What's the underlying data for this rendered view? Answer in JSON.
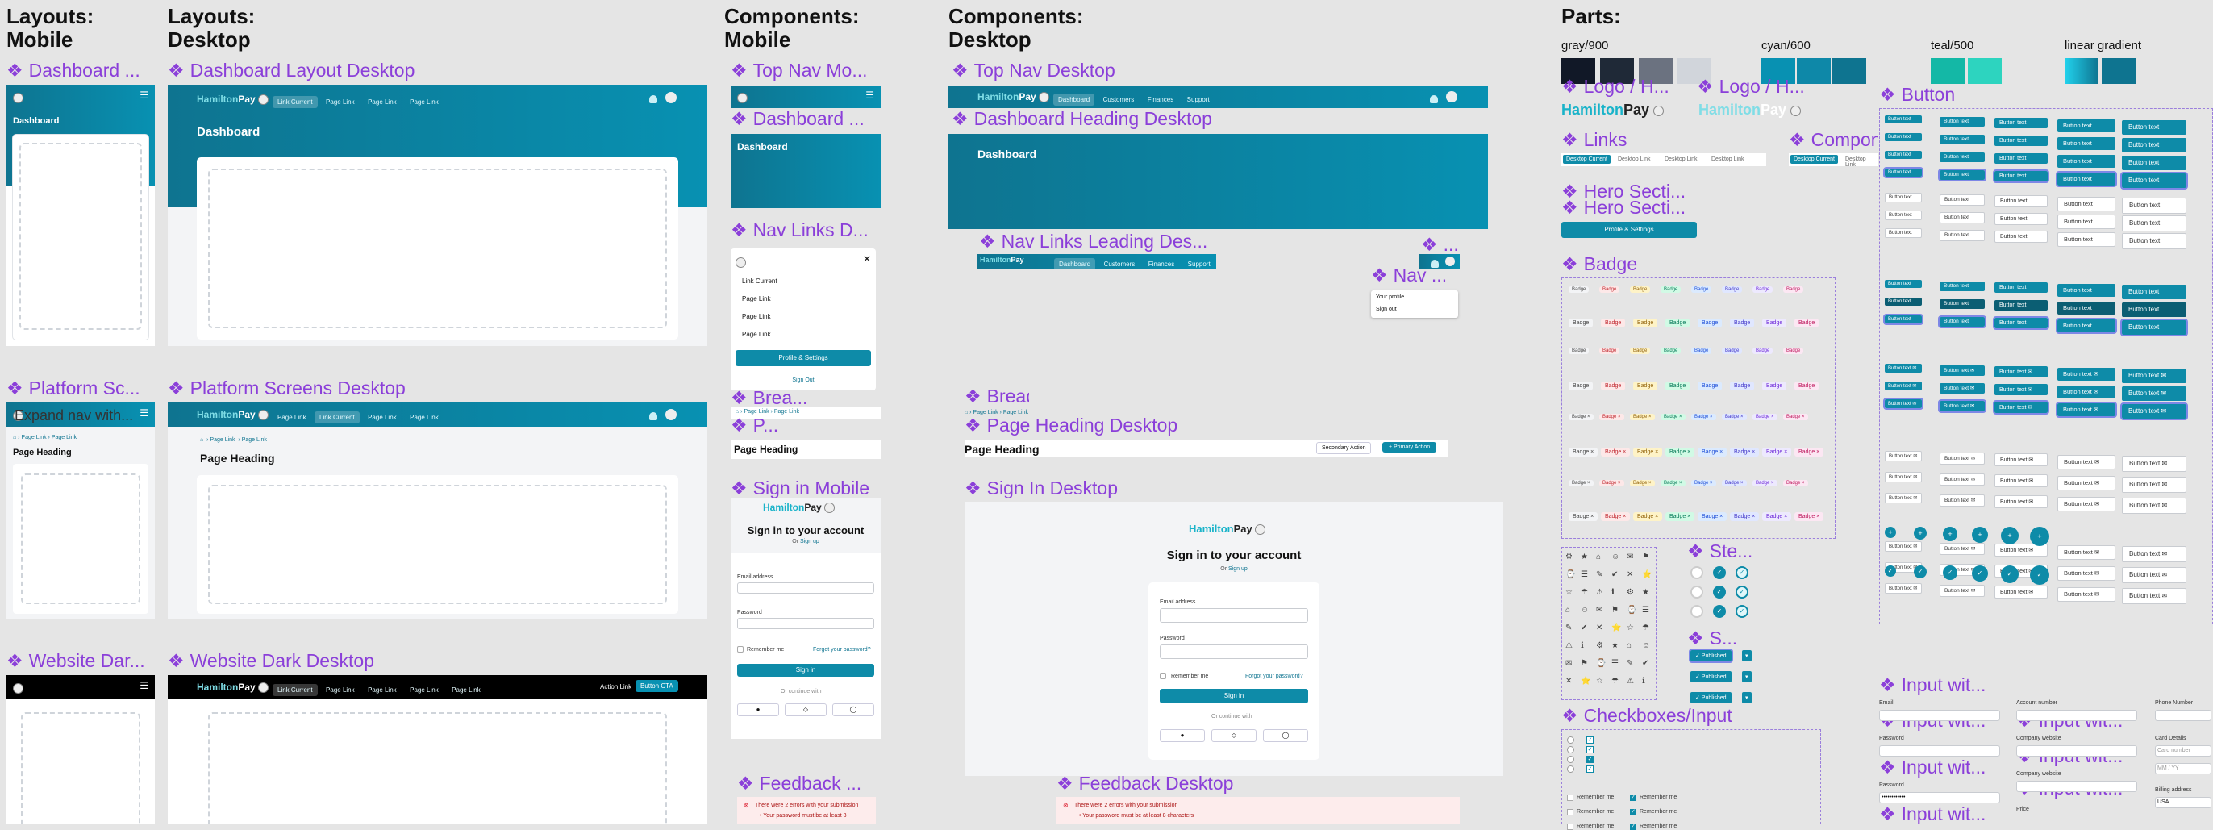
{
  "sections": {
    "layouts_mobile": [
      "Layouts:",
      "Mobile"
    ],
    "layouts_desktop": [
      "Layouts:",
      "Desktop"
    ],
    "components_mobile": [
      "Components:",
      "Mobile"
    ],
    "components_desktop": [
      "Components:",
      "Desktop"
    ],
    "parts": "Parts:"
  },
  "labels": {
    "dashboard_mobile": "Dashboard ...",
    "dashboard_desktop": "Dashboard Layout Desktop",
    "platform_mobile": "Platform Sc...",
    "platform_desktop": "Platform Screens Desktop",
    "website_mobile": "Website Dar...",
    "website_desktop": "Website Dark Desktop",
    "top_nav_mobile": "Top Nav Mo...",
    "top_nav_desktop": "Top Nav Desktop",
    "dash_heading_mobile": "Dashboard ...",
    "dash_heading_desktop": "Dashboard Heading Desktop",
    "nav_links_mobile": "Nav Links D...",
    "nav_links_leading": "Nav Links Leading Des...",
    "nav_trailing": "Nav ...",
    "nav_trailing_dots": "...",
    "bread_mobile": "Brea...",
    "page_mobile": "P...",
    "bread_desktop": "Bread...",
    "page_heading_desktop": "Page Heading Desktop",
    "signin_mobile": "Sign in Mobile",
    "signin_desktop": "Sign In Desktop",
    "feedback_mobile": "Feedback ...",
    "feedback_desktop": "Feedback Desktop",
    "logo_h1": "Logo / H...",
    "logo_h2": "Logo / H...",
    "links": "Links",
    "compon": "Compon...",
    "hero1": "Hero Secti...",
    "hero2": "Hero Secti...",
    "badge": "Badge",
    "button": "Button",
    "steps": "Ste...",
    "s": "S...",
    "checkboxes": "Checkboxes/Input",
    "input1": "Input wit...",
    "input2": "Input wit...",
    "input3": "Input wit...",
    "input4": "Input wit...",
    "input5": "Input wit...",
    "input6": "Input wit...",
    "input7": "Input wit..."
  },
  "swatches": {
    "gray": {
      "label": "gray/900",
      "colors": [
        "#111827",
        "#1f2937",
        "#6b7280",
        "#d1d5db"
      ]
    },
    "cyan": {
      "label": "cyan/600",
      "colors": [
        "#0891b2",
        "#0e88a8",
        "#0e7490"
      ]
    },
    "teal": {
      "label": "teal/500",
      "colors": [
        "#14b8a6",
        "#2dd4bf"
      ]
    },
    "gradient": {
      "label": "linear gradient",
      "colors": [
        "#22d3ee",
        "#0e7490"
      ]
    }
  },
  "brand": {
    "hamilton": "Hamilton",
    "pay": "Pay"
  },
  "nav": {
    "link_current": "Link Current",
    "page_link": "Page Link",
    "dashboard": "Dashboard",
    "customers": "Customers",
    "finances": "Finances",
    "support": "Support",
    "action_link": "Action Link",
    "button_cta": "Button CTA",
    "profile_settings": "Profile & Settings",
    "sign_out": "Sign Out",
    "your_profile": "Your profile",
    "sign_out_lower": "Sign out"
  },
  "headings": {
    "dashboard": "Dashboard",
    "page_heading": "Page Heading",
    "expand_nav": "Expand nav with..."
  },
  "page_heading_actions": {
    "secondary": "Secondary Action",
    "primary": "Primary Action"
  },
  "signin": {
    "title": "Sign in to your account",
    "or": "Or",
    "sign_up": "Sign up",
    "email": "Email address",
    "password": "Password",
    "remember": "Remember me",
    "forgot": "Forgot your password?",
    "button": "Sign in",
    "continue": "Or continue with"
  },
  "feedback": {
    "title": "There were 2 errors with your submission",
    "item_mobile": "Your password must be at least 8",
    "item_desktop": "Your password must be at least 8 characters"
  },
  "links_part": {
    "current": "Desktop Current",
    "link": "Desktop Link"
  },
  "badges": {
    "text": "Badge"
  },
  "buttons": {
    "text": "Button text"
  },
  "split": {
    "published": "Published"
  },
  "inputs": {
    "email": "Email",
    "password": "Password",
    "account": "Account number",
    "company": "Company website",
    "price": "Price",
    "phone": "Phone Number",
    "card": "Card Details",
    "card_number": "Card number",
    "mm_yy": "MM / YY",
    "billing": "Billing address",
    "country": "USA",
    "password_dots": "••••••••••••"
  },
  "checks": {
    "remember": "Remember me"
  }
}
